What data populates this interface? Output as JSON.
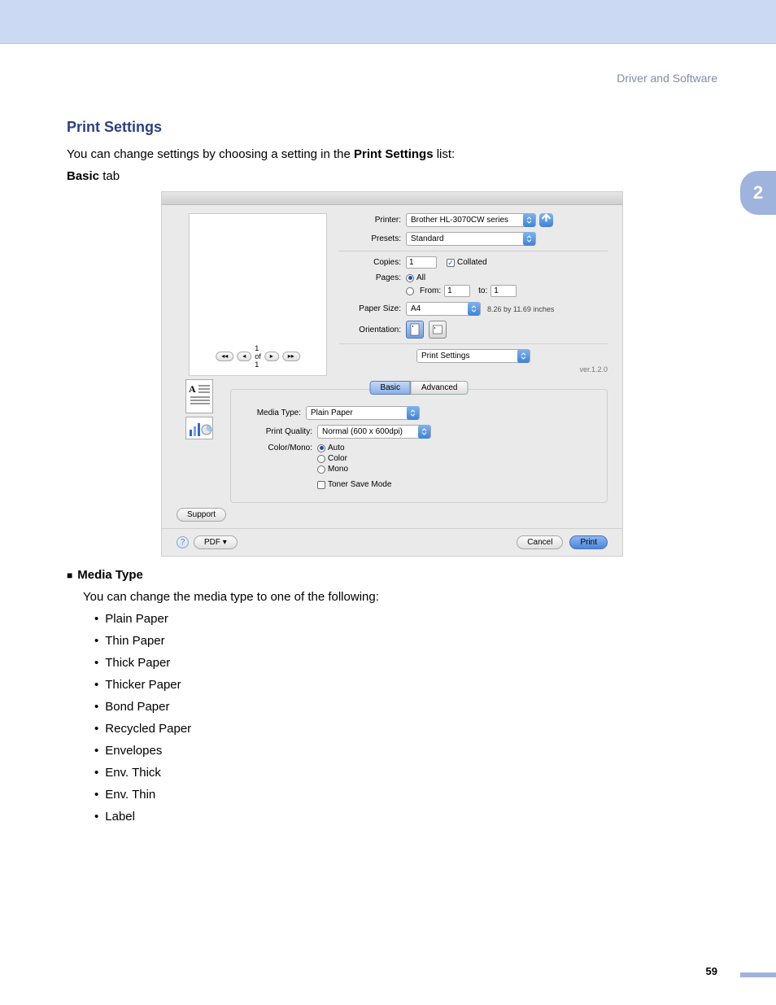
{
  "section_header": "Driver and Software",
  "chapter_number": "2",
  "heading": "Print Settings",
  "intro_pre": "You can change settings by choosing a setting in the ",
  "intro_bold": "Print Settings",
  "intro_post": " list:",
  "subhead": "Basic",
  "subhead_post": " tab",
  "dialog": {
    "printer_label": "Printer:",
    "printer_value": "Brother HL-3070CW series",
    "presets_label": "Presets:",
    "presets_value": "Standard",
    "copies_label": "Copies:",
    "copies_value": "1",
    "collated_label": "Collated",
    "pages_label": "Pages:",
    "pages_all": "All",
    "pages_from_label": "From:",
    "pages_from_value": "1",
    "pages_to_label": "to:",
    "pages_to_value": "1",
    "papersize_label": "Paper Size:",
    "papersize_value": "A4",
    "papersize_dims": "8.26 by 11.69 inches",
    "orientation_label": "Orientation:",
    "section_select": "Print Settings",
    "version": "ver.1.2.0",
    "tab_basic": "Basic",
    "tab_advanced": "Advanced",
    "mediatype_label": "Media Type:",
    "mediatype_value": "Plain Paper",
    "printquality_label": "Print Quality:",
    "printquality_value": "Normal (600 x 600dpi)",
    "colormono_label": "Color/Mono:",
    "cm_auto": "Auto",
    "cm_color": "Color",
    "cm_mono": "Mono",
    "tonersave_label": "Toner Save Mode",
    "support_btn": "Support",
    "preview_pager": "1 of 1",
    "pdf_btn": "PDF ▾",
    "cancel_btn": "Cancel",
    "print_btn": "Print"
  },
  "mediatype_heading": "Media Type",
  "mediatype_intro": "You can change the media type to one of the following:",
  "media_items": [
    "Plain Paper",
    "Thin Paper",
    "Thick Paper",
    "Thicker Paper",
    "Bond Paper",
    "Recycled Paper",
    "Envelopes",
    "Env. Thick",
    "Env. Thin",
    "Label"
  ],
  "page_number": "59"
}
